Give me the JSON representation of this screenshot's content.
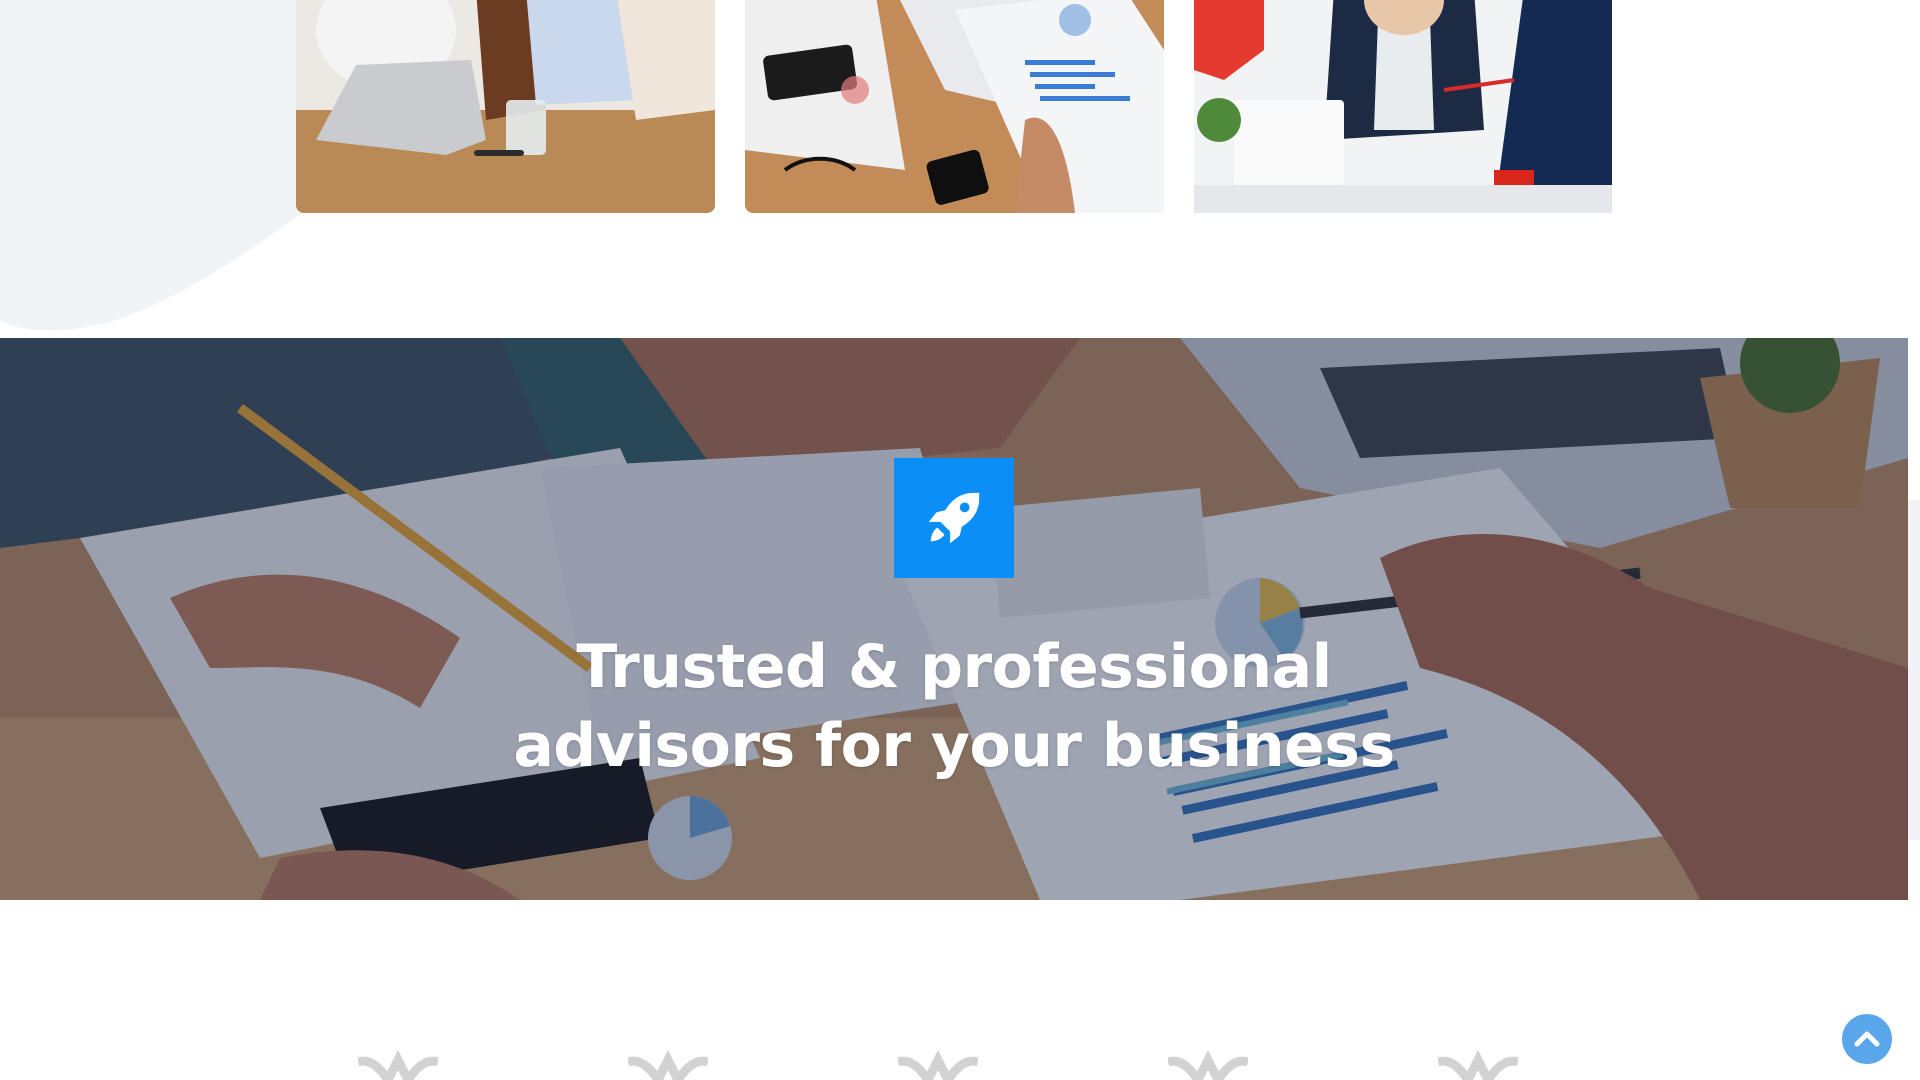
{
  "hero": {
    "title_line1": "Trusted & professional",
    "title_line2": "advisors for your business",
    "icon": "rocket-icon",
    "icon_bg_color": "#0b8ef5"
  },
  "cards": [
    {
      "image": "team-laptop-meeting-photo"
    },
    {
      "image": "financial-charts-photo"
    },
    {
      "image": "business-presentation-photo"
    }
  ],
  "back_to_top": {
    "icon": "chevron-up-icon",
    "color": "#5aa6ea"
  },
  "colors": {
    "blob": "#f1f4f7",
    "overlay": "#1e2846"
  }
}
